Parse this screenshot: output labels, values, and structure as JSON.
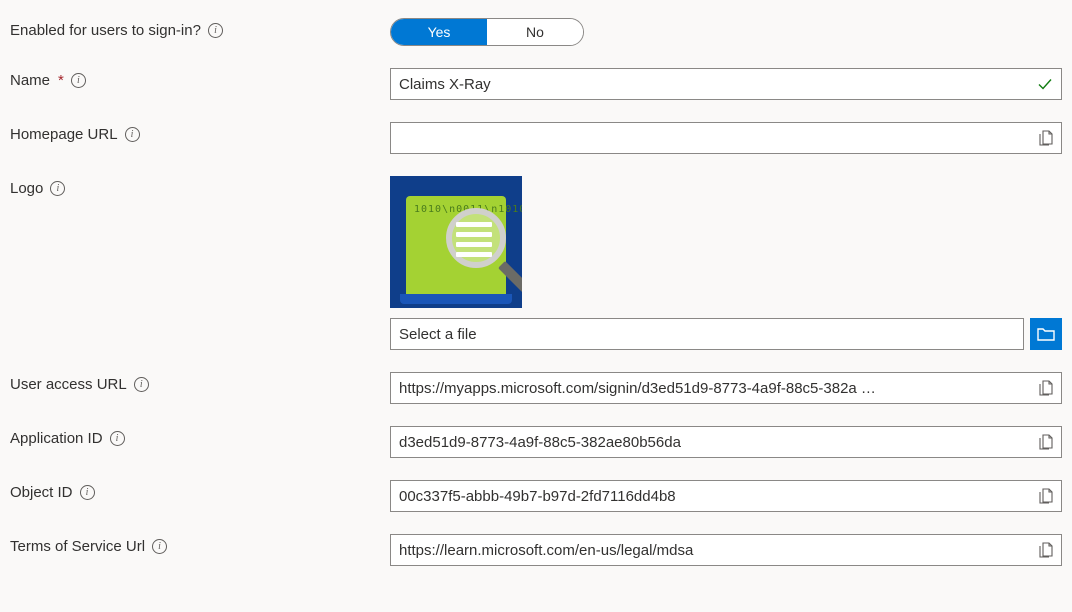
{
  "fields": {
    "enabled": {
      "label": "Enabled for users to sign-in?",
      "yes": "Yes",
      "no": "No",
      "value": "Yes"
    },
    "name": {
      "label": "Name",
      "required": true,
      "value": "Claims X-Ray",
      "valid": true
    },
    "homepage_url": {
      "label": "Homepage URL",
      "value": ""
    },
    "logo": {
      "label": "Logo",
      "file_placeholder": "Select a file"
    },
    "user_access_url": {
      "label": "User access URL",
      "value": "https://myapps.microsoft.com/signin/d3ed51d9-8773-4a9f-88c5-382a …"
    },
    "application_id": {
      "label": "Application ID",
      "value": "d3ed51d9-8773-4a9f-88c5-382ae80b56da"
    },
    "object_id": {
      "label": "Object ID",
      "value": "00c337f5-abbb-49b7-b97d-2fd7116dd4b8"
    },
    "terms_of_service_url": {
      "label": "Terms of Service Url",
      "value": "https://learn.microsoft.com/en-us/legal/mdsa"
    }
  }
}
